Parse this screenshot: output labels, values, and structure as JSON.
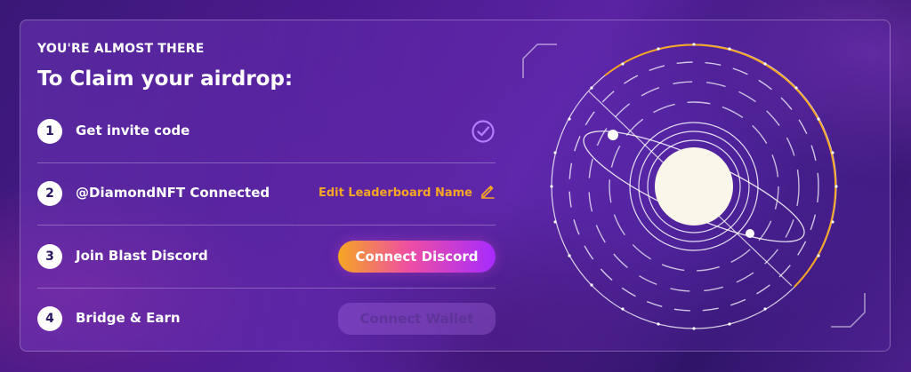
{
  "header": {
    "eyebrow": "YOU'RE ALMOST THERE",
    "title": "To Claim your airdrop:"
  },
  "steps": [
    {
      "number": "1",
      "label": "Get invite code",
      "status": "completed",
      "icon": "check-circle-icon"
    },
    {
      "number": "2",
      "label": "@DiamondNFT Connected",
      "action_label": "Edit Leaderboard Name",
      "action_icon": "pencil-icon"
    },
    {
      "number": "3",
      "label": "Join Blast Discord",
      "button_label": "Connect Discord"
    },
    {
      "number": "4",
      "label": "Bridge & Earn",
      "button_label": "Connect Wallet",
      "button_state": "disabled"
    }
  ],
  "colors": {
    "accent_orange": "#f5a623",
    "check_purple": "#b57bff",
    "discord_gradient": [
      "#f5a623",
      "#ee4ea3",
      "#a62bff"
    ],
    "planet": "#fbf6ea"
  },
  "graphic": {
    "icon": "orbit-planet-illustration"
  }
}
